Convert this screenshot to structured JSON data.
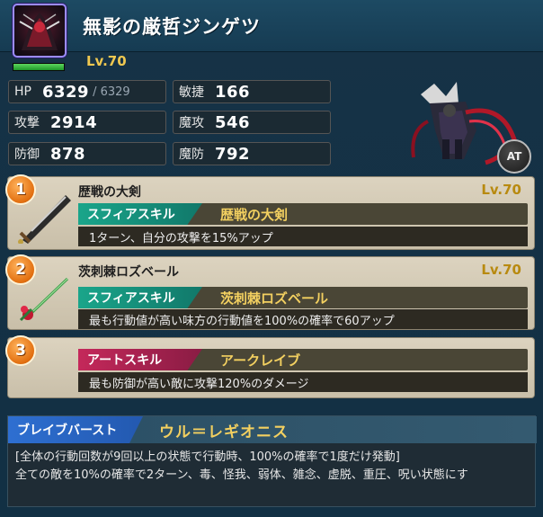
{
  "unit": {
    "name": "無影の厳哲ジンゲツ",
    "level": "Lv.70",
    "hp_fill": 1.0,
    "avatar_icon": "dark-armored-knight-portrait",
    "attack_type_badge": "AT"
  },
  "stats": {
    "hp": {
      "label": "HP",
      "value": "6329",
      "max": "/ 6329"
    },
    "agility": {
      "label": "敏捷",
      "value": "166"
    },
    "attack": {
      "label": "攻撃",
      "value": "2914"
    },
    "magic_attack": {
      "label": "魔攻",
      "value": "546"
    },
    "defense": {
      "label": "防御",
      "value": "878"
    },
    "magic_defense": {
      "label": "魔防",
      "value": "792"
    }
  },
  "skills": [
    {
      "number": "1",
      "name": "歴戦の大剣",
      "level": "Lv.70",
      "type_label": "スフィアスキル",
      "type_name": "歴戦の大剣",
      "description": "1ターン、自分の攻撃を15%アップ",
      "icon": "greatsword-icon"
    },
    {
      "number": "2",
      "name": "茨刺棘ロズベール",
      "level": "Lv.70",
      "type_label": "スフィアスキル",
      "type_name": "茨刺棘ロズベール",
      "description": "最も行動値が高い味方の行動値を100%の確率で60アップ",
      "icon": "rose-sword-icon"
    },
    {
      "number": "3",
      "type_label": "アートスキル",
      "type_name": "アークレイブ",
      "description": "最も防御が高い敵に攻撃120%のダメージ"
    }
  ],
  "brave_burst": {
    "label": "ブレイブバースト",
    "name": "ウル＝レギオニス",
    "line1": "[全体の行動回数が9回以上の状態で行動時、100%の確率で1度だけ発動]",
    "line2": "全ての敵を10%の確率で2ターン、毒、怪我、弱体、雑念、虚脱、重圧、呪い状態にす"
  },
  "colors": {
    "sphere_tag": "#1aa58a",
    "art_tag": "#c4285a",
    "brave_tag": "#2e6fd1",
    "level_gold": "#f0c850",
    "number_badge": "#e26f10"
  }
}
